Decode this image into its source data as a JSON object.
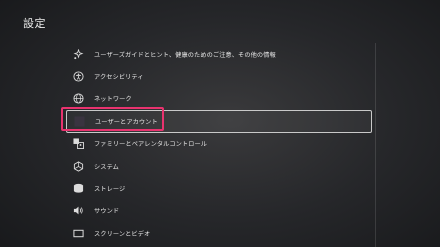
{
  "header": {
    "title": "設定"
  },
  "menu": {
    "items": [
      {
        "label": "ユーザーズガイドとヒント、健康のためのご注意、その他の情報",
        "icon": "help-sparkle-icon"
      },
      {
        "label": "アクセシビリティ",
        "icon": "accessibility-icon"
      },
      {
        "label": "ネットワーク",
        "icon": "globe-icon"
      },
      {
        "label": "ユーザーとアカウント",
        "icon": "user-account-icon",
        "selected": true
      },
      {
        "label": "ファミリーとペアレンタルコントロール",
        "icon": "family-icon"
      },
      {
        "label": "システム",
        "icon": "system-icon"
      },
      {
        "label": "ストレージ",
        "icon": "storage-icon"
      },
      {
        "label": "サウンド",
        "icon": "speaker-icon"
      },
      {
        "label": "スクリーンとビデオ",
        "icon": "screen-icon"
      }
    ]
  },
  "colors": {
    "highlight": "#e9336f",
    "text": "#e6e6e6"
  }
}
